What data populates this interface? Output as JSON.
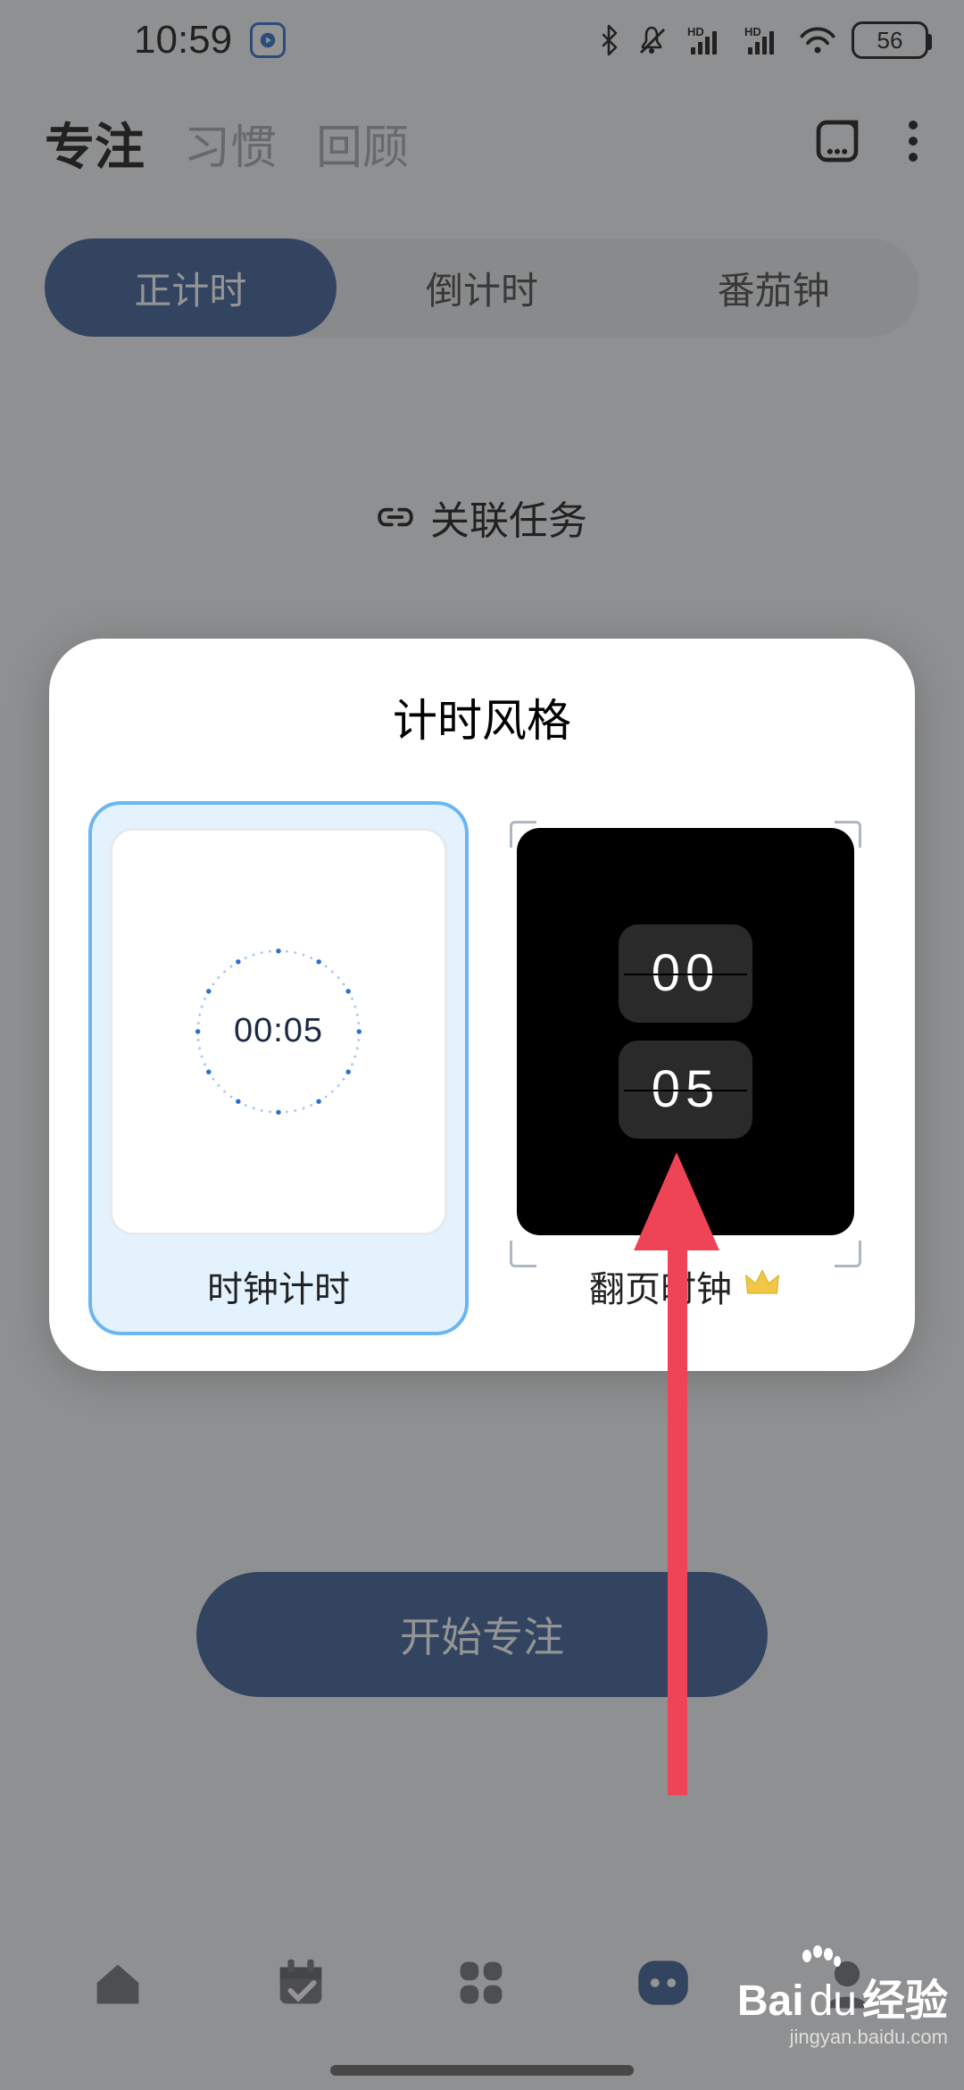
{
  "status": {
    "time": "10:59",
    "battery": "56"
  },
  "topTabs": {
    "items": [
      "专注",
      "习惯",
      "回顾"
    ],
    "activeIndex": 0
  },
  "segmented": {
    "items": [
      "正计时",
      "倒计时",
      "番茄钟"
    ],
    "activeIndex": 0
  },
  "linkTask": "关联任务",
  "startButton": "开始专注",
  "modal": {
    "title": "计时风格",
    "options": [
      {
        "label": "时钟计时",
        "time": "00:05",
        "selected": true,
        "premium": false
      },
      {
        "label": "翻页时钟",
        "flipTop": "00",
        "flipBottom": "05",
        "selected": false,
        "premium": true
      }
    ]
  },
  "watermark": {
    "brand_a": "Bai",
    "brand_b": "du",
    "brand_c": "经验",
    "url": "jingyan.baidu.com"
  }
}
